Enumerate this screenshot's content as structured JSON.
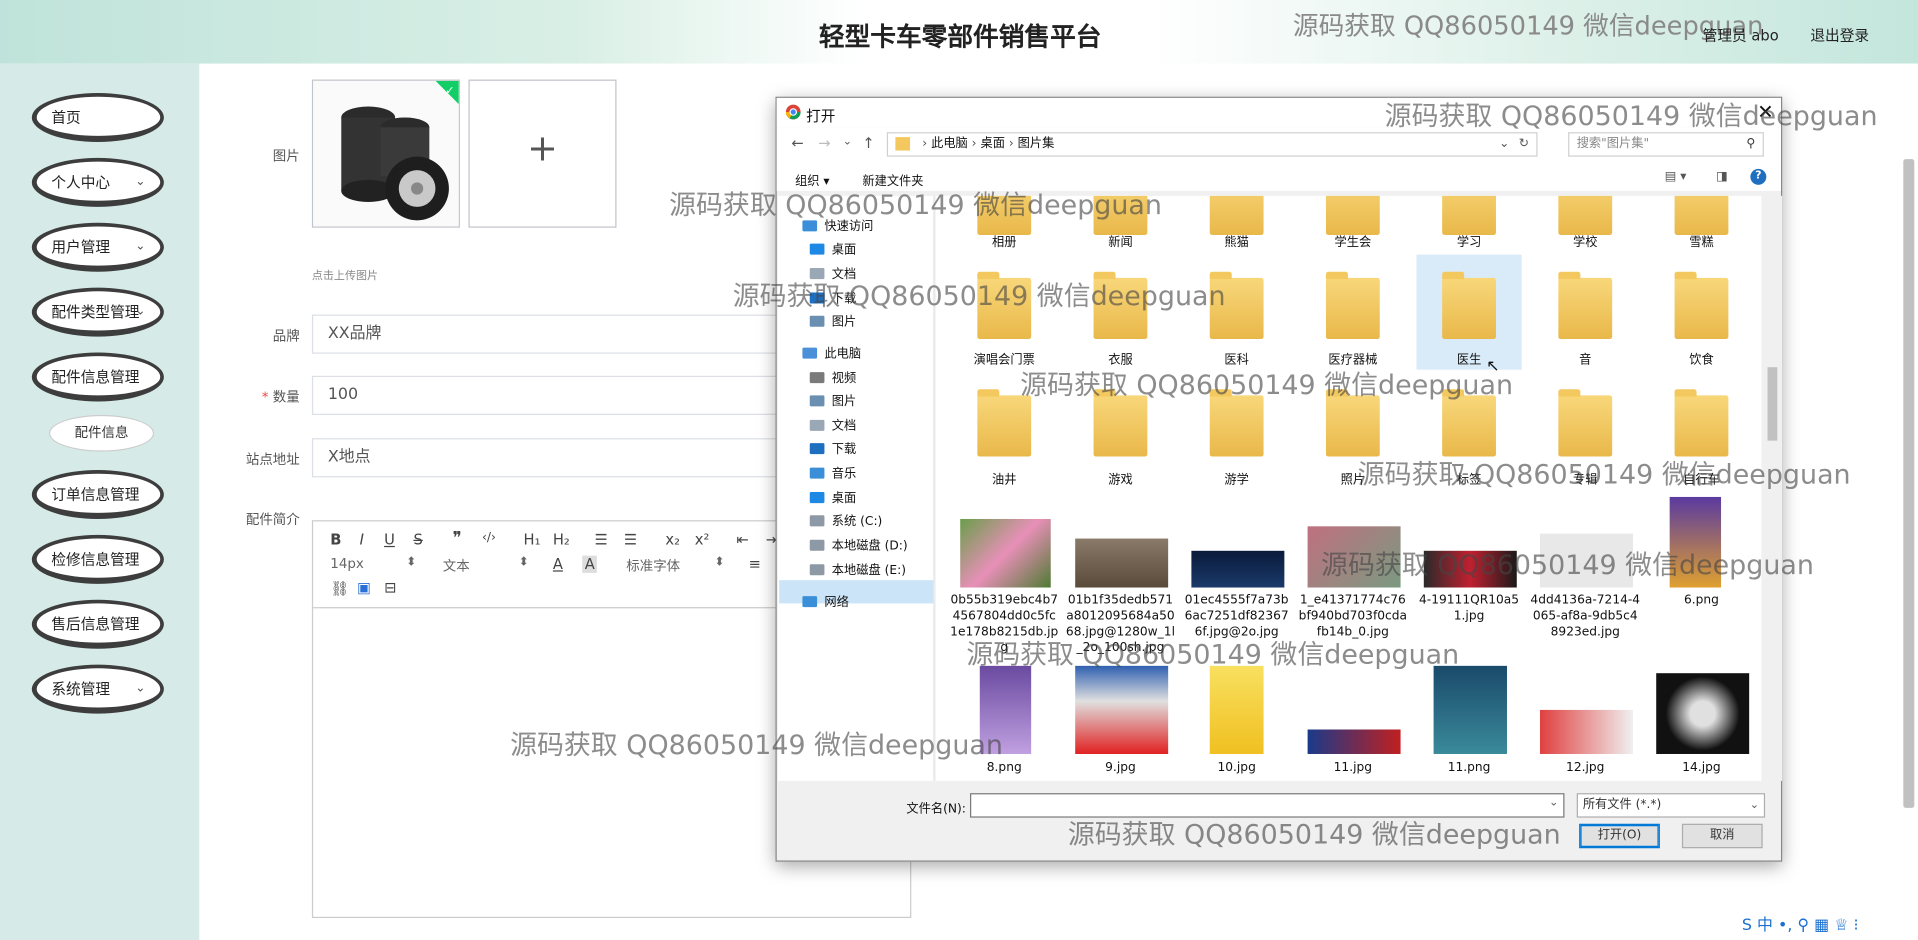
{
  "header": {
    "title": "轻型卡车零部件销售平台",
    "user": "管理员 abo",
    "logout": "退出登录"
  },
  "sidebar": {
    "items": [
      {
        "label": "首页",
        "chev": ""
      },
      {
        "label": "个人中心",
        "chev": "⌄"
      },
      {
        "label": "用户管理",
        "chev": "⌄"
      },
      {
        "label": "配件类型管理",
        "chev": "⌄"
      },
      {
        "label": "配件信息管理",
        "chev": ""
      },
      {
        "label": "订单信息管理",
        "chev": ""
      },
      {
        "label": "检修信息管理",
        "chev": ""
      },
      {
        "label": "售后信息管理",
        "chev": ""
      },
      {
        "label": "系统管理",
        "chev": "⌄"
      }
    ],
    "sub_item": "配件信息"
  },
  "form": {
    "image_label": "图片",
    "upload_hint": "点击上传图片",
    "plus": "+",
    "brand_label": "品牌",
    "brand_value": "XX品牌",
    "qty_req": "*",
    "qty_label": "数量",
    "qty_value": "100",
    "site_label": "站点地址",
    "site_value": "X地点",
    "desc_label": "配件简介",
    "toolbar": {
      "font_size": "14px",
      "para": "文本",
      "font": "标准字体"
    }
  },
  "dialog": {
    "title": "打开",
    "path": [
      "此电脑",
      "桌面",
      "图片集"
    ],
    "search_placeholder": "搜索\"图片集\"",
    "organize": "组织 ▾",
    "new_folder": "新建文件夹",
    "nav": [
      {
        "label": "快速访问",
        "color": "#3b8fd9"
      },
      {
        "label": "桌面",
        "color": "#1e88e5"
      },
      {
        "label": "文档",
        "color": "#9aa7b4"
      },
      {
        "label": "下载",
        "color": "#1e6fc0"
      },
      {
        "label": "图片",
        "color": "#6a8fb0"
      },
      {
        "label": "此电脑",
        "color": "#4a90d9"
      },
      {
        "label": "视频",
        "color": "#7a7a7a"
      },
      {
        "label": "图片",
        "color": "#6a8fb0"
      },
      {
        "label": "文档",
        "color": "#9aa7b4"
      },
      {
        "label": "下载",
        "color": "#1e6fc0"
      },
      {
        "label": "音乐",
        "color": "#3b8fd9"
      },
      {
        "label": "桌面",
        "color": "#1e88e5"
      },
      {
        "label": "系统 (C:)",
        "color": "#8e99a6"
      },
      {
        "label": "本地磁盘 (D:)",
        "color": "#8e99a6"
      },
      {
        "label": "本地磁盘 (E:)",
        "color": "#8e99a6"
      },
      {
        "label": "网络",
        "color": "#3b8fd9"
      }
    ],
    "folders_row1": [
      "相册",
      "新闻",
      "熊猫",
      "学生会",
      "学习",
      "学校",
      "雪糕"
    ],
    "folders_row2": [
      "演唱会门票",
      "衣服",
      "医科",
      "医疗器械",
      "医生",
      "音",
      "饮食"
    ],
    "folders_row3": [
      "油井",
      "游戏",
      "游学",
      "照片",
      "标签",
      "专辑",
      "自行车"
    ],
    "files_row4": [
      "0b55b319ebc4b74567804dd0c5fc1e178b8215db.jpg",
      "01b1f35dedb571a8012095684a5068.jpg@1280w_1l_2o_100sh.jpg",
      "01ec4555f7a73b6ac7251df823676f.jpg@2o.jpg",
      "1_e41371774c76bf940bd703f0cdafb14b_0.jpg",
      "4-19111QR10a51.jpg",
      "4dd4136a-7214-4065-af8a-9db5c48923ed.jpg",
      "6.png"
    ],
    "files_row5": [
      "8.png",
      "9.jpg",
      "10.jpg",
      "11.jpg",
      "11.png",
      "12.jpg",
      "14.jpg"
    ],
    "filename_label": "文件名(N):",
    "filetype": "所有文件 (*.*)",
    "open": "打开(O)",
    "cancel": "取消"
  },
  "watermark": "源码获取 QQ86050149 微信deepguan",
  "ime": "S 中 •, ⚲ ▦ ♕ ⁝"
}
